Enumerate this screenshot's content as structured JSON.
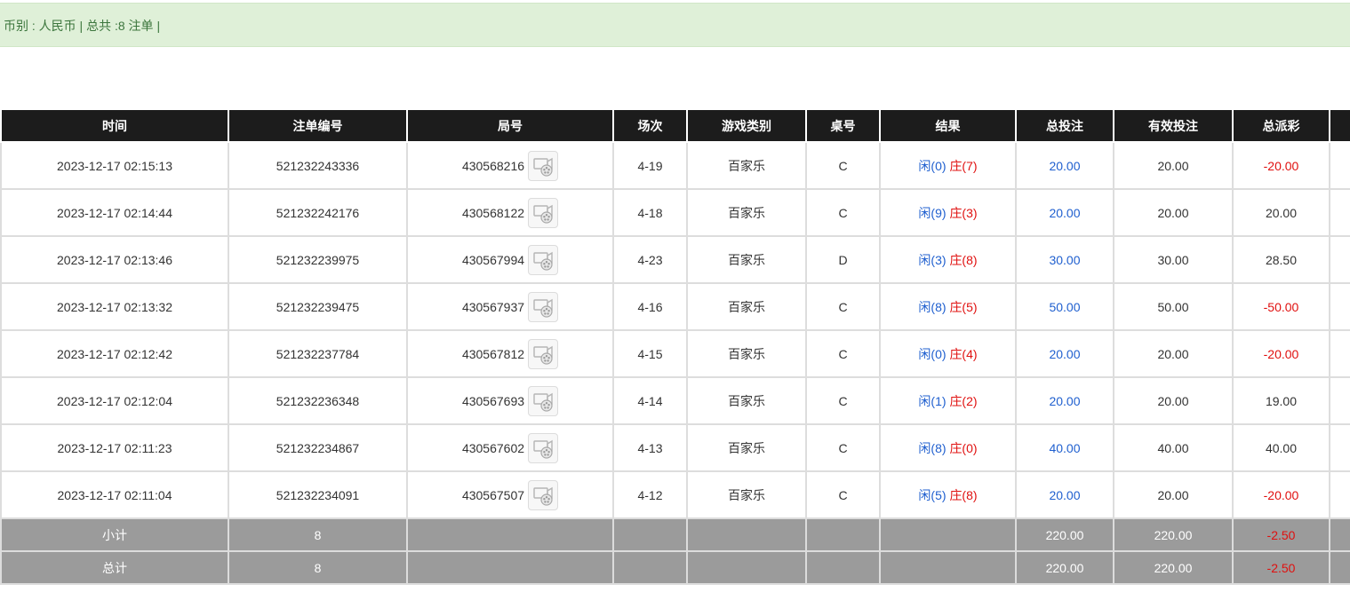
{
  "summary": {
    "currency_label": "币别 : 人民币",
    "separator": " | ",
    "total_label": "总共 :8 注单",
    "trailing": " |"
  },
  "columns": [
    "时间",
    "注单编号",
    "局号",
    "场次",
    "游戏类别",
    "桌号",
    "结果",
    "总投注",
    "有效投注",
    "总派彩"
  ],
  "rows": [
    {
      "time": "2023-12-17 02:15:13",
      "bet_id": "521232243336",
      "round": "430568216",
      "session": "4-19",
      "game": "百家乐",
      "table": "C",
      "player": "闲(0)",
      "banker": "庄(7)",
      "total_bet": "20.00",
      "valid_bet": "20.00",
      "payout": "-20.00"
    },
    {
      "time": "2023-12-17 02:14:44",
      "bet_id": "521232242176",
      "round": "430568122",
      "session": "4-18",
      "game": "百家乐",
      "table": "C",
      "player": "闲(9)",
      "banker": "庄(3)",
      "total_bet": "20.00",
      "valid_bet": "20.00",
      "payout": "20.00"
    },
    {
      "time": "2023-12-17 02:13:46",
      "bet_id": "521232239975",
      "round": "430567994",
      "session": "4-23",
      "game": "百家乐",
      "table": "D",
      "player": "闲(3)",
      "banker": "庄(8)",
      "total_bet": "30.00",
      "valid_bet": "30.00",
      "payout": "28.50"
    },
    {
      "time": "2023-12-17 02:13:32",
      "bet_id": "521232239475",
      "round": "430567937",
      "session": "4-16",
      "game": "百家乐",
      "table": "C",
      "player": "闲(8)",
      "banker": "庄(5)",
      "total_bet": "50.00",
      "valid_bet": "50.00",
      "payout": "-50.00"
    },
    {
      "time": "2023-12-17 02:12:42",
      "bet_id": "521232237784",
      "round": "430567812",
      "session": "4-15",
      "game": "百家乐",
      "table": "C",
      "player": "闲(0)",
      "banker": "庄(4)",
      "total_bet": "20.00",
      "valid_bet": "20.00",
      "payout": "-20.00"
    },
    {
      "time": "2023-12-17 02:12:04",
      "bet_id": "521232236348",
      "round": "430567693",
      "session": "4-14",
      "game": "百家乐",
      "table": "C",
      "player": "闲(1)",
      "banker": "庄(2)",
      "total_bet": "20.00",
      "valid_bet": "20.00",
      "payout": "19.00"
    },
    {
      "time": "2023-12-17 02:11:23",
      "bet_id": "521232234867",
      "round": "430567602",
      "session": "4-13",
      "game": "百家乐",
      "table": "C",
      "player": "闲(8)",
      "banker": "庄(0)",
      "total_bet": "40.00",
      "valid_bet": "40.00",
      "payout": "40.00"
    },
    {
      "time": "2023-12-17 02:11:04",
      "bet_id": "521232234091",
      "round": "430567507",
      "session": "4-12",
      "game": "百家乐",
      "table": "C",
      "player": "闲(5)",
      "banker": "庄(8)",
      "total_bet": "20.00",
      "valid_bet": "20.00",
      "payout": "-20.00"
    }
  ],
  "subtotal": {
    "label": "小计",
    "count": "8",
    "total_bet": "220.00",
    "valid_bet": "220.00",
    "payout": "-2.50"
  },
  "grandtotal": {
    "label": "总计",
    "count": "8",
    "total_bet": "220.00",
    "valid_bet": "220.00",
    "payout": "-2.50"
  },
  "colors": {
    "info_bg": "#dff0d8",
    "info_text": "#3c763d",
    "header_bg": "#1c1c1c",
    "footer_bg": "#9b9b9b",
    "player_blue": "#1f5fcf",
    "negative_red": "#e0100f"
  },
  "icons": {
    "replay": "video-replay-icon"
  }
}
